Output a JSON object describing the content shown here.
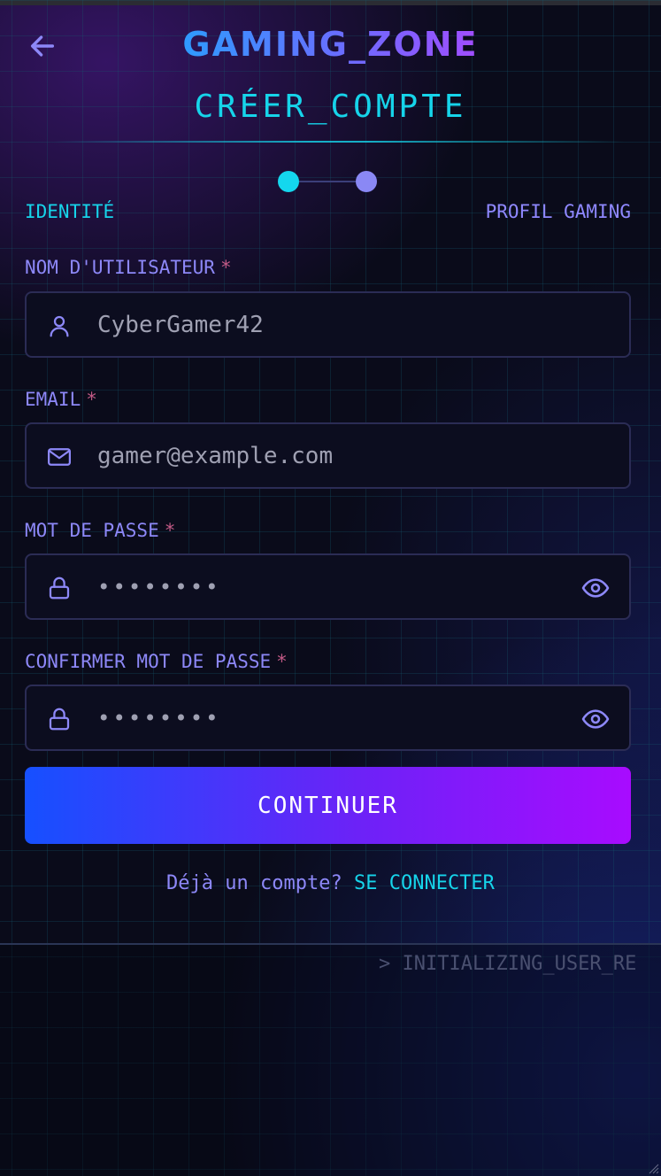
{
  "app": {
    "brand": "GAMING_ZONE",
    "page_title": "CRÉER_COMPTE"
  },
  "steps": [
    {
      "label": "IDENTITÉ",
      "active": true,
      "color": "#16d4ea"
    },
    {
      "label": "PROFIL GAMING",
      "active": false,
      "color": "#8f88ff"
    }
  ],
  "form": {
    "username": {
      "label": "NOM D'UTILISATEUR",
      "required_mark": "*",
      "value": "CyberGamer42",
      "icon": "user-icon"
    },
    "email": {
      "label": "EMAIL",
      "required_mark": "*",
      "value": "gamer@example.com",
      "icon": "mail-icon"
    },
    "password": {
      "label": "MOT DE PASSE",
      "required_mark": "*",
      "value": "••••••••",
      "icon": "lock-icon",
      "toggle_icon": "eye-icon"
    },
    "confirm_password": {
      "label": "CONFIRMER MOT DE PASSE",
      "required_mark": "*",
      "value": "••••••••",
      "icon": "lock-icon",
      "toggle_icon": "eye-icon"
    }
  },
  "actions": {
    "continue_label": "CONTINUER",
    "login_prompt": "Déjà un compte?",
    "login_link": "SE CONNECTER"
  },
  "terminal": {
    "text": "> INITIALIZING_USER_RE"
  },
  "colors": {
    "accent_cyan": "#16d4ea",
    "accent_violet": "#8d88f8",
    "button_start": "#1650ff",
    "button_end": "#a80bff",
    "required": "#c25a86"
  }
}
